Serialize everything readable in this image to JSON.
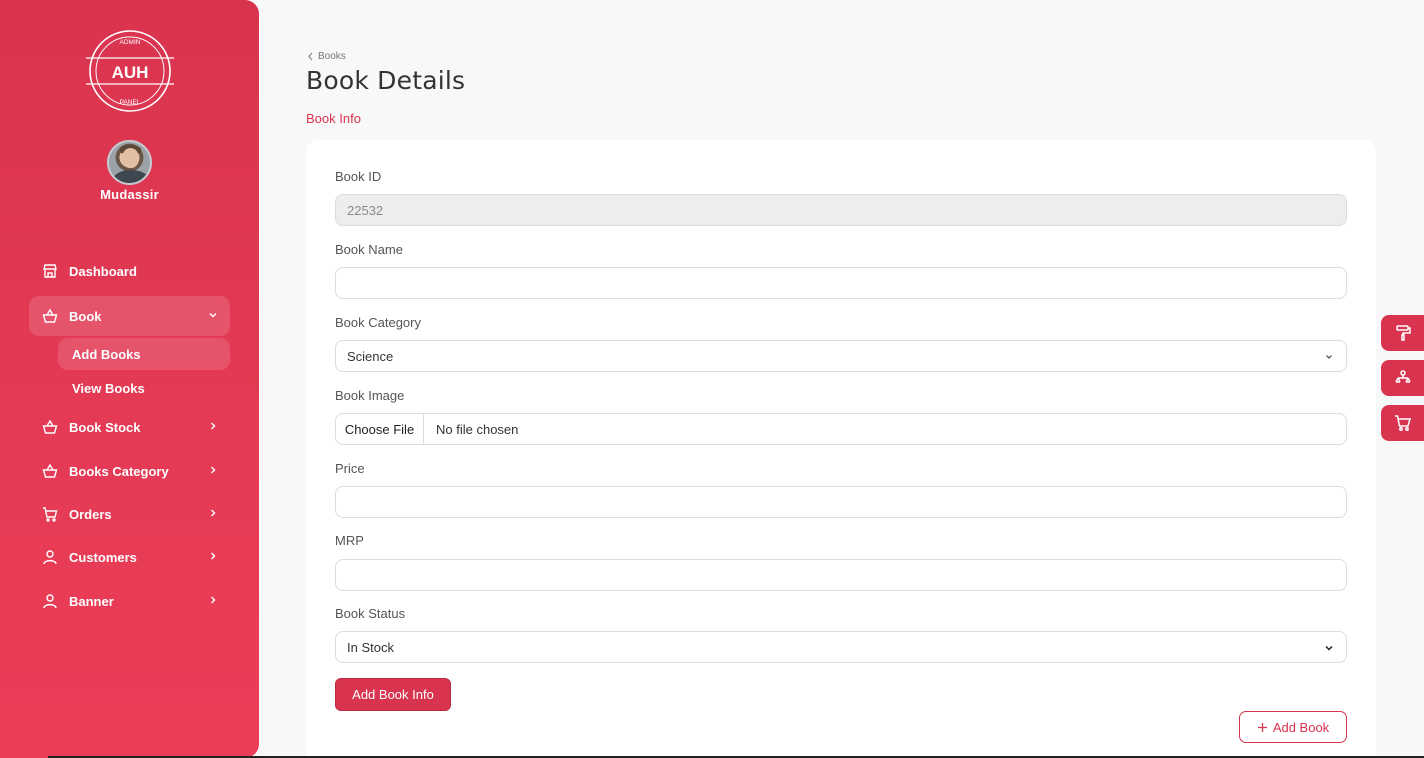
{
  "sidebar": {
    "logo": {
      "top_text": "ADMIN",
      "main_text": "AUH",
      "bottom_text": "PANEL"
    },
    "user": {
      "name": "Mudassir"
    },
    "nav": {
      "dashboard": "Dashboard",
      "book": "Book",
      "add_books": "Add Books",
      "view_books": "View Books",
      "book_stock": "Book Stock",
      "books_category": "Books Category",
      "orders": "Orders",
      "customers": "Customers",
      "banner": "Banner"
    }
  },
  "header": {
    "breadcrumb": "Books",
    "title": "Book Details",
    "section": "Book Info"
  },
  "form": {
    "book_id": {
      "label": "Book ID",
      "value": "22532"
    },
    "book_name": {
      "label": "Book Name",
      "value": ""
    },
    "book_category": {
      "label": "Book Category",
      "value": "Science"
    },
    "book_image": {
      "label": "Book Image",
      "button": "Choose File",
      "status": "No file chosen"
    },
    "price": {
      "label": "Price",
      "value": ""
    },
    "mrp": {
      "label": "MRP",
      "value": ""
    },
    "book_status": {
      "label": "Book Status",
      "value": "In Stock"
    },
    "submit_label": "Add Book Info"
  },
  "actions": {
    "add_book_label": "Add Book"
  },
  "floating_tools": [
    "paint-roller-icon",
    "sitemap-icon",
    "cart-icon"
  ],
  "colors": {
    "accent": "#d8344f",
    "sidebar": "#e13853"
  }
}
